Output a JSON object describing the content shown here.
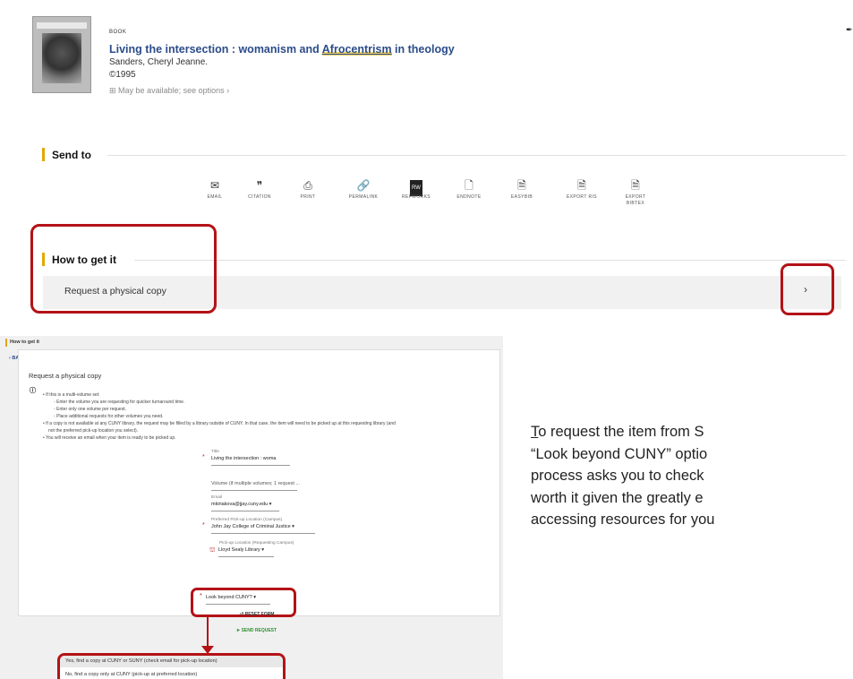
{
  "top": {
    "item_type": "BOOK",
    "title_part1": "Living the intersection : womanism and ",
    "title_highlight": "Afrocentrism",
    "title_part2": " in theology",
    "author": "Sanders, Cheryl Jeanne.",
    "year": "©1995",
    "availability": "May be available; see options",
    "send_to_title": "Send to",
    "send_items": [
      {
        "label": "EMAIL",
        "icon": "envelope-icon"
      },
      {
        "label": "CITATION",
        "icon": "quote-icon"
      },
      {
        "label": "PRINT",
        "icon": "printer-icon"
      },
      {
        "label": "PERMALINK",
        "icon": "link-icon"
      },
      {
        "label": "REFWORKS",
        "icon": "refworks-icon",
        "glyph": "RW"
      },
      {
        "label": "ENDNOTE",
        "icon": "document-icon"
      },
      {
        "label": "EASYBIB",
        "icon": "bib-document-icon"
      },
      {
        "label": "EXPORT RIS",
        "icon": "export-document-icon"
      },
      {
        "label": "EXPORT BIBTEX",
        "icon": "export-bibtex-icon"
      }
    ],
    "how_to_get_title": "How to get it",
    "request_label": "Request a physical copy"
  },
  "form": {
    "section_title": "How to get it",
    "back_label": "BACK",
    "panel_title": "Request a physical copy",
    "bullets": [
      "If this is a multi-volume set:",
      "Enter the volume you are requesting for quicker turnaround time.",
      "Enter only one volume per request.",
      "Place additional requests for other volumes you need.",
      "If a copy is not available at any CUNY library, the request may be filled by a library outside of CUNY. In that case, the item will need to be picked up at this requesting library (and",
      "not the preferred pick-up location you select).",
      "You will receive an email when your item is ready to be picked up."
    ],
    "title_label": "Title",
    "title_value": "Living the intersection : woma",
    "volume_placeholder": "Volume (if multiple volumes; 1 request ...",
    "email_label": "Email",
    "email_value": "mkiriakova@jjay.cuny.edu",
    "pickup_pref_label": "Preferred Pick-up Location (Campus)",
    "pickup_pref_value": "John Jay College of Criminal Justice",
    "pickup_req_label": "Pick-up Location (Requesting Campus)",
    "pickup_req_value": "Lloyd Sealy Library",
    "look_beyond_value": "Look beyond CUNY?",
    "reset_label": "RESET FORM",
    "send_label": "SEND REQUEST",
    "option_yes": "Yes, find a copy at CUNY or SUNY (check email for pick-up location)",
    "option_no": "No, find a copy only at CUNY (pick-up at preferred location)"
  },
  "explanation": {
    "first_letter": "T",
    "line1_rest": "o request the item from S",
    "line2": "“Look beyond CUNY” optio",
    "line3": "process asks you to check",
    "line4": "worth it given the greatly e",
    "line5": "accessing resources for you"
  },
  "colors": {
    "accent_red": "#b31217",
    "title_blue": "#2b4c8a",
    "section_gold": "#e2a700",
    "send_green": "#2f8f2f"
  }
}
